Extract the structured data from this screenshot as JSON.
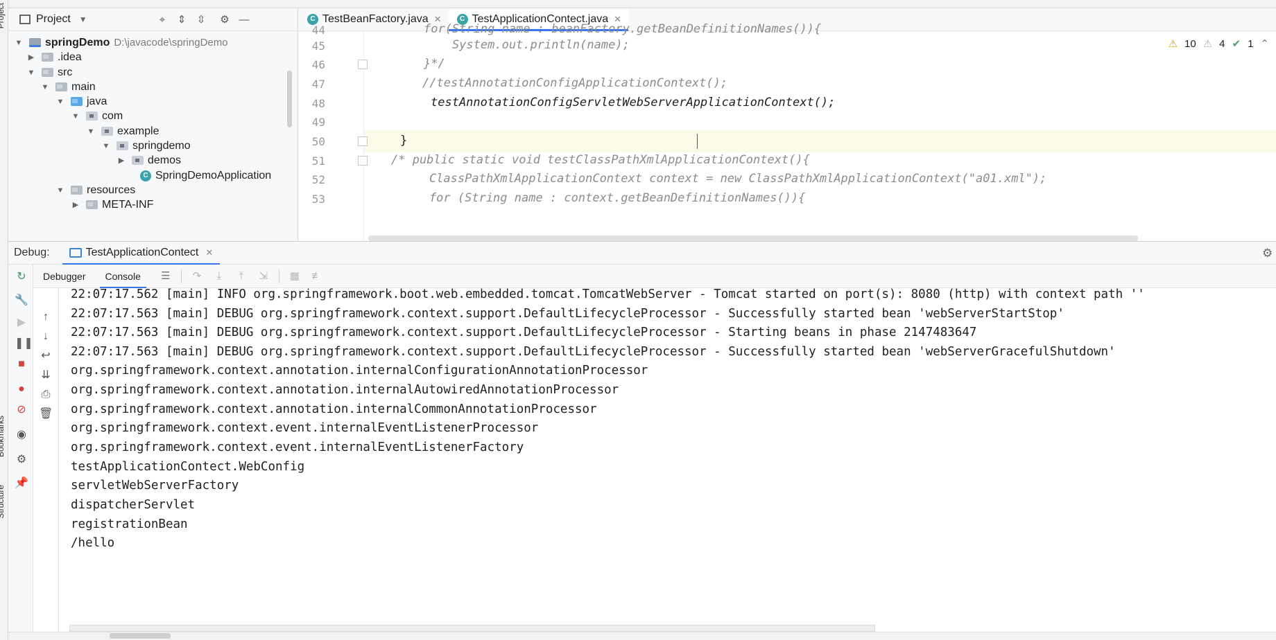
{
  "side_labels": {
    "project": "Project",
    "bookmarks": "Bookmarks",
    "structure": "Structure"
  },
  "project": {
    "title": "Project",
    "tree": [
      {
        "label": "springDemo",
        "path": "D:\\javacode\\springDemo"
      },
      {
        "label": ".idea"
      },
      {
        "label": "src"
      },
      {
        "label": "main"
      },
      {
        "label": "java"
      },
      {
        "label": "com"
      },
      {
        "label": "example"
      },
      {
        "label": "springdemo"
      },
      {
        "label": "demos"
      },
      {
        "label": "SpringDemoApplication"
      },
      {
        "label": "resources"
      },
      {
        "label": "META-INF"
      }
    ]
  },
  "editor": {
    "tabs": [
      {
        "label": "TestBeanFactory.java",
        "close": "✕"
      },
      {
        "label": "TestApplicationContect.java",
        "close": "✕"
      }
    ],
    "inspections": {
      "warnings": "10",
      "weak_warnings": "4",
      "ok": "1"
    },
    "lines": [
      {
        "number": "44",
        "text": "for(String name : beanFactory.getBeanDefinitionNames()){"
      },
      {
        "number": "45",
        "text": "    System.out.println(name);"
      },
      {
        "number": "46",
        "text": "}*/"
      },
      {
        "number": "47",
        "text": "//testAnnotationConfigApplicationContext();"
      },
      {
        "number": "48",
        "text": "testAnnotationConfigServletWebServerApplicationContext();"
      },
      {
        "number": "49",
        "text": ""
      },
      {
        "number": "50",
        "text": "}"
      },
      {
        "number": "51",
        "text": "/* public static void testClassPathXmlApplicationContext(){"
      },
      {
        "number": "52",
        "text": "    ClassPathXmlApplicationContext context = new ClassPathXmlApplicationContext(\"a01.xml\");"
      },
      {
        "number": "53",
        "text": "    for (String name : context.getBeanDefinitionNames()){"
      }
    ]
  },
  "debug": {
    "label": "Debug:",
    "session_tab": "TestApplicationContect",
    "subtabs": [
      "Debugger",
      "Console"
    ],
    "console_lines": [
      "22:07:17.562 [main] INFO org.springframework.boot.web.embedded.tomcat.TomcatWebServer - Tomcat started on port(s): 8080 (http) with context path ''",
      "22:07:17.563 [main] DEBUG org.springframework.context.support.DefaultLifecycleProcessor - Successfully started bean 'webServerStartStop'",
      "22:07:17.563 [main] DEBUG org.springframework.context.support.DefaultLifecycleProcessor - Starting beans in phase 2147483647",
      "22:07:17.563 [main] DEBUG org.springframework.context.support.DefaultLifecycleProcessor - Successfully started bean 'webServerGracefulShutdown'",
      "org.springframework.context.annotation.internalConfigurationAnnotationProcessor",
      "org.springframework.context.annotation.internalAutowiredAnnotationProcessor",
      "org.springframework.context.annotation.internalCommonAnnotationProcessor",
      "org.springframework.context.event.internalEventListenerProcessor",
      "org.springframework.context.event.internalEventListenerFactory",
      "testApplicationContect.WebConfig",
      "servletWebServerFactory",
      "dispatcherServlet",
      "registrationBean",
      "/hello"
    ]
  },
  "colors": {
    "accent": "#3874f0",
    "warning": "#e3a21a",
    "ok": "#4aa06a",
    "current_line": "#fbfbe8"
  }
}
